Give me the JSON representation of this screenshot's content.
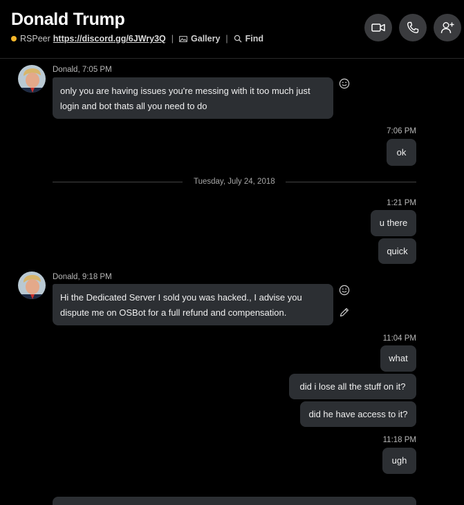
{
  "header": {
    "title": "Donald Trump",
    "server_name": "RSPeer",
    "server_link": "https://discord.gg/6JWry3Q",
    "gallery_label": "Gallery",
    "find_label": "Find",
    "status_color": "#f6b62a"
  },
  "messages": {
    "m1_meta": "Donald, 7:05 PM",
    "m1_line1": "only you are having issues you're messing with it too much just",
    "m1_line2": "login and bot thats all you need to do",
    "m2_time": "7:06 PM",
    "m2_text": "ok",
    "divider_date": "Tuesday, July 24, 2018",
    "m3_time": "1:21 PM",
    "m3_text": "u there",
    "m4_text": "quick",
    "m5_meta": "Donald, 9:18 PM",
    "m5_line1": "Hi the Dedicated Server I sold you was hacked., I advise you",
    "m5_line2": "dispute me on OSBot for a full refund and compensation.",
    "m6_time": "11:04 PM",
    "m6_text": "what",
    "m7_text": "did i lose all the stuff on it?",
    "m8_text": "did he have access to it?",
    "m9_time": "11:18 PM",
    "m9_text": "ugh"
  },
  "colors": {
    "background": "#000000",
    "bubble": "#2c2f33",
    "header_button": "#3a3b3e"
  }
}
